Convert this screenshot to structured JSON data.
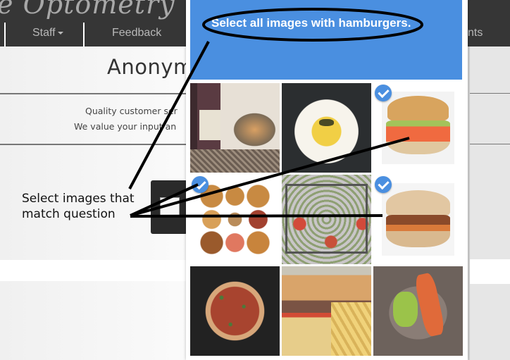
{
  "background_site": {
    "logo_text": "e Optometry",
    "nav": [
      {
        "label": "Staff",
        "has_dropdown": true
      },
      {
        "label": "Feedback",
        "has_dropdown": false
      },
      {
        "label": "nts",
        "has_dropdown": false
      }
    ],
    "page_title": "Anonym",
    "subtitle_line1": "Quality customer ser",
    "subtitle_line2": "We value your input an"
  },
  "annotation": {
    "label_line1": "Select images that",
    "label_line2": "match question"
  },
  "captcha": {
    "prompt": "Select all images with hamburgers.",
    "accent_color": "#4a8fe0",
    "tiles": [
      {
        "subject": "wine-and-vegetables",
        "selected": false
      },
      {
        "subject": "pasta-plate",
        "selected": false
      },
      {
        "subject": "hamburger",
        "selected": true
      },
      {
        "subject": "hamburger-collage",
        "selected": true
      },
      {
        "subject": "shrimp-platter",
        "selected": false
      },
      {
        "subject": "hamburger",
        "selected": true
      },
      {
        "subject": "pizza",
        "selected": false
      },
      {
        "subject": "hamburger-with-fries",
        "selected": false
      },
      {
        "subject": "crab-dish",
        "selected": false
      }
    ]
  }
}
